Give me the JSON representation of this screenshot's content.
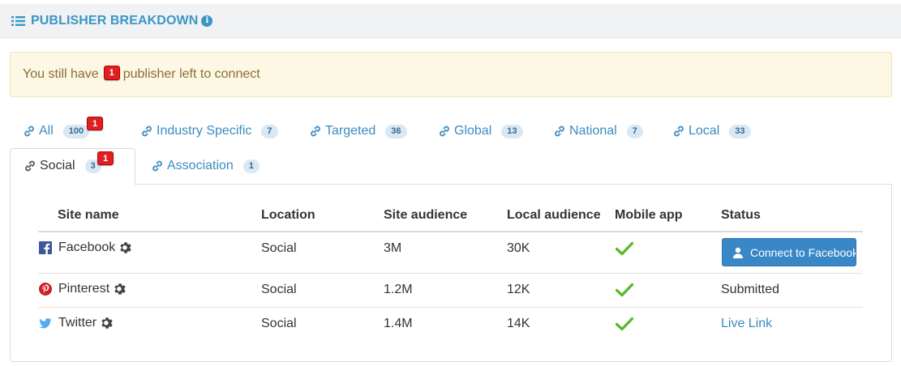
{
  "header": {
    "title": "PUBLISHER BREAKDOWN",
    "title_icon": "list-icon",
    "info_icon": "info-icon"
  },
  "alert": {
    "prefix": "You still have",
    "count": "1",
    "suffix": "publisher left to connect"
  },
  "tabs": [
    {
      "label": "All",
      "count": "100",
      "alert_badge": "1",
      "icon": "link-icon"
    },
    {
      "label": "Industry Specific",
      "count": "7",
      "icon": "link-icon"
    },
    {
      "label": "Targeted",
      "count": "36",
      "icon": "link-icon"
    },
    {
      "label": "Global",
      "count": "13",
      "icon": "link-icon"
    },
    {
      "label": "National",
      "count": "7",
      "icon": "link-icon"
    },
    {
      "label": "Local",
      "count": "33",
      "icon": "link-icon"
    },
    {
      "label": "Social",
      "count": "3",
      "alert_badge": "1",
      "icon": "link-icon",
      "active": true
    },
    {
      "label": "Association",
      "count": "1",
      "icon": "link-icon"
    }
  ],
  "table": {
    "headers": [
      "Site name",
      "Location",
      "Site audience",
      "Local audience",
      "Mobile app",
      "Status"
    ],
    "rows": [
      {
        "site": "Facebook",
        "icon": "facebook-icon",
        "location": "Social",
        "site_audience": "3M",
        "local_audience": "30K",
        "mobile_app": true,
        "status": "Connect to Facebook",
        "status_type": "button"
      },
      {
        "site": "Pinterest",
        "icon": "pinterest-icon",
        "location": "Social",
        "site_audience": "1.2M",
        "local_audience": "12K",
        "mobile_app": true,
        "status": "Submitted",
        "status_type": "text"
      },
      {
        "site": "Twitter",
        "icon": "twitter-icon",
        "location": "Social",
        "site_audience": "1.4M",
        "local_audience": "14K",
        "mobile_app": true,
        "status": "Live Link",
        "status_type": "link"
      }
    ]
  },
  "colors": {
    "accent": "#3a96c5",
    "link": "#3b8bc2",
    "alert_bg": "#fcf8e3",
    "alert_text": "#8a6d3b",
    "badge_red": "#e02020",
    "pill_bg": "#d9e8f3",
    "button_blue": "#3a87c8",
    "check_green": "#5cb82e",
    "facebook": "#3b5998",
    "pinterest": "#cb2027",
    "twitter": "#55acee"
  }
}
